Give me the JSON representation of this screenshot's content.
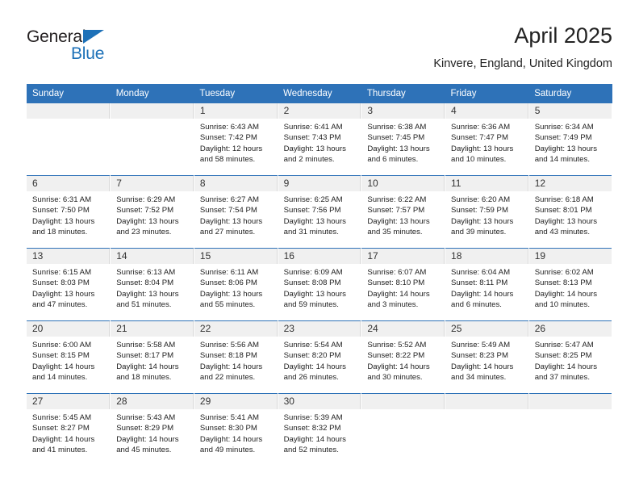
{
  "brand": {
    "name_top": "General",
    "name_bottom": "Blue",
    "accent_color": "#1d71b8"
  },
  "header": {
    "month_title": "April 2025",
    "location": "Kinvere, England, United Kingdom"
  },
  "theme": {
    "header_blue": "#2e72b8",
    "daynum_band": "#f0f0f0"
  },
  "weekday_headers": [
    "Sunday",
    "Monday",
    "Tuesday",
    "Wednesday",
    "Thursday",
    "Friday",
    "Saturday"
  ],
  "weeks": [
    [
      {
        "day": "",
        "empty": true
      },
      {
        "day": "",
        "empty": true
      },
      {
        "day": "1",
        "sunrise": "Sunrise: 6:43 AM",
        "sunset": "Sunset: 7:42 PM",
        "daylight_line1": "Daylight: 12 hours",
        "daylight_line2": "and 58 minutes."
      },
      {
        "day": "2",
        "sunrise": "Sunrise: 6:41 AM",
        "sunset": "Sunset: 7:43 PM",
        "daylight_line1": "Daylight: 13 hours",
        "daylight_line2": "and 2 minutes."
      },
      {
        "day": "3",
        "sunrise": "Sunrise: 6:38 AM",
        "sunset": "Sunset: 7:45 PM",
        "daylight_line1": "Daylight: 13 hours",
        "daylight_line2": "and 6 minutes."
      },
      {
        "day": "4",
        "sunrise": "Sunrise: 6:36 AM",
        "sunset": "Sunset: 7:47 PM",
        "daylight_line1": "Daylight: 13 hours",
        "daylight_line2": "and 10 minutes."
      },
      {
        "day": "5",
        "sunrise": "Sunrise: 6:34 AM",
        "sunset": "Sunset: 7:49 PM",
        "daylight_line1": "Daylight: 13 hours",
        "daylight_line2": "and 14 minutes."
      }
    ],
    [
      {
        "day": "6",
        "sunrise": "Sunrise: 6:31 AM",
        "sunset": "Sunset: 7:50 PM",
        "daylight_line1": "Daylight: 13 hours",
        "daylight_line2": "and 18 minutes."
      },
      {
        "day": "7",
        "sunrise": "Sunrise: 6:29 AM",
        "sunset": "Sunset: 7:52 PM",
        "daylight_line1": "Daylight: 13 hours",
        "daylight_line2": "and 23 minutes."
      },
      {
        "day": "8",
        "sunrise": "Sunrise: 6:27 AM",
        "sunset": "Sunset: 7:54 PM",
        "daylight_line1": "Daylight: 13 hours",
        "daylight_line2": "and 27 minutes."
      },
      {
        "day": "9",
        "sunrise": "Sunrise: 6:25 AM",
        "sunset": "Sunset: 7:56 PM",
        "daylight_line1": "Daylight: 13 hours",
        "daylight_line2": "and 31 minutes."
      },
      {
        "day": "10",
        "sunrise": "Sunrise: 6:22 AM",
        "sunset": "Sunset: 7:57 PM",
        "daylight_line1": "Daylight: 13 hours",
        "daylight_line2": "and 35 minutes."
      },
      {
        "day": "11",
        "sunrise": "Sunrise: 6:20 AM",
        "sunset": "Sunset: 7:59 PM",
        "daylight_line1": "Daylight: 13 hours",
        "daylight_line2": "and 39 minutes."
      },
      {
        "day": "12",
        "sunrise": "Sunrise: 6:18 AM",
        "sunset": "Sunset: 8:01 PM",
        "daylight_line1": "Daylight: 13 hours",
        "daylight_line2": "and 43 minutes."
      }
    ],
    [
      {
        "day": "13",
        "sunrise": "Sunrise: 6:15 AM",
        "sunset": "Sunset: 8:03 PM",
        "daylight_line1": "Daylight: 13 hours",
        "daylight_line2": "and 47 minutes."
      },
      {
        "day": "14",
        "sunrise": "Sunrise: 6:13 AM",
        "sunset": "Sunset: 8:04 PM",
        "daylight_line1": "Daylight: 13 hours",
        "daylight_line2": "and 51 minutes."
      },
      {
        "day": "15",
        "sunrise": "Sunrise: 6:11 AM",
        "sunset": "Sunset: 8:06 PM",
        "daylight_line1": "Daylight: 13 hours",
        "daylight_line2": "and 55 minutes."
      },
      {
        "day": "16",
        "sunrise": "Sunrise: 6:09 AM",
        "sunset": "Sunset: 8:08 PM",
        "daylight_line1": "Daylight: 13 hours",
        "daylight_line2": "and 59 minutes."
      },
      {
        "day": "17",
        "sunrise": "Sunrise: 6:07 AM",
        "sunset": "Sunset: 8:10 PM",
        "daylight_line1": "Daylight: 14 hours",
        "daylight_line2": "and 3 minutes."
      },
      {
        "day": "18",
        "sunrise": "Sunrise: 6:04 AM",
        "sunset": "Sunset: 8:11 PM",
        "daylight_line1": "Daylight: 14 hours",
        "daylight_line2": "and 6 minutes."
      },
      {
        "day": "19",
        "sunrise": "Sunrise: 6:02 AM",
        "sunset": "Sunset: 8:13 PM",
        "daylight_line1": "Daylight: 14 hours",
        "daylight_line2": "and 10 minutes."
      }
    ],
    [
      {
        "day": "20",
        "sunrise": "Sunrise: 6:00 AM",
        "sunset": "Sunset: 8:15 PM",
        "daylight_line1": "Daylight: 14 hours",
        "daylight_line2": "and 14 minutes."
      },
      {
        "day": "21",
        "sunrise": "Sunrise: 5:58 AM",
        "sunset": "Sunset: 8:17 PM",
        "daylight_line1": "Daylight: 14 hours",
        "daylight_line2": "and 18 minutes."
      },
      {
        "day": "22",
        "sunrise": "Sunrise: 5:56 AM",
        "sunset": "Sunset: 8:18 PM",
        "daylight_line1": "Daylight: 14 hours",
        "daylight_line2": "and 22 minutes."
      },
      {
        "day": "23",
        "sunrise": "Sunrise: 5:54 AM",
        "sunset": "Sunset: 8:20 PM",
        "daylight_line1": "Daylight: 14 hours",
        "daylight_line2": "and 26 minutes."
      },
      {
        "day": "24",
        "sunrise": "Sunrise: 5:52 AM",
        "sunset": "Sunset: 8:22 PM",
        "daylight_line1": "Daylight: 14 hours",
        "daylight_line2": "and 30 minutes."
      },
      {
        "day": "25",
        "sunrise": "Sunrise: 5:49 AM",
        "sunset": "Sunset: 8:23 PM",
        "daylight_line1": "Daylight: 14 hours",
        "daylight_line2": "and 34 minutes."
      },
      {
        "day": "26",
        "sunrise": "Sunrise: 5:47 AM",
        "sunset": "Sunset: 8:25 PM",
        "daylight_line1": "Daylight: 14 hours",
        "daylight_line2": "and 37 minutes."
      }
    ],
    [
      {
        "day": "27",
        "sunrise": "Sunrise: 5:45 AM",
        "sunset": "Sunset: 8:27 PM",
        "daylight_line1": "Daylight: 14 hours",
        "daylight_line2": "and 41 minutes."
      },
      {
        "day": "28",
        "sunrise": "Sunrise: 5:43 AM",
        "sunset": "Sunset: 8:29 PM",
        "daylight_line1": "Daylight: 14 hours",
        "daylight_line2": "and 45 minutes."
      },
      {
        "day": "29",
        "sunrise": "Sunrise: 5:41 AM",
        "sunset": "Sunset: 8:30 PM",
        "daylight_line1": "Daylight: 14 hours",
        "daylight_line2": "and 49 minutes."
      },
      {
        "day": "30",
        "sunrise": "Sunrise: 5:39 AM",
        "sunset": "Sunset: 8:32 PM",
        "daylight_line1": "Daylight: 14 hours",
        "daylight_line2": "and 52 minutes."
      },
      {
        "day": "",
        "empty": true
      },
      {
        "day": "",
        "empty": true
      },
      {
        "day": "",
        "empty": true
      }
    ]
  ]
}
